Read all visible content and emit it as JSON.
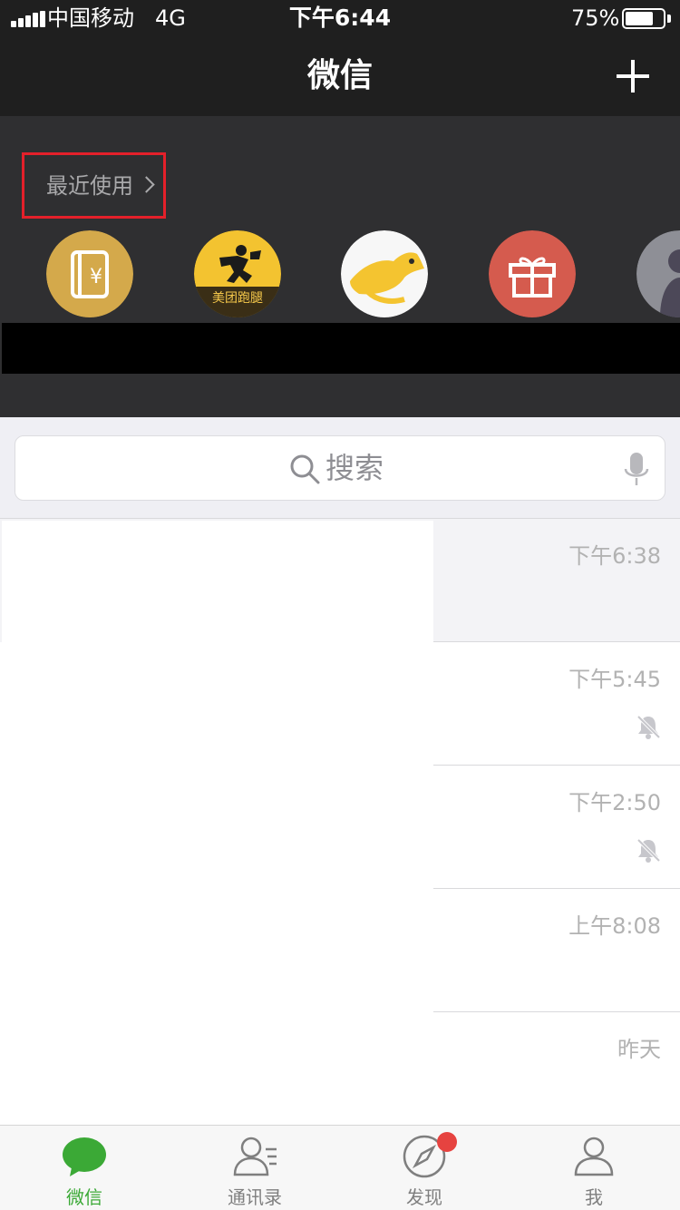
{
  "status_bar": {
    "carrier": "中国移动",
    "network": "4G",
    "time": "下午6:44",
    "battery_percent": "75%",
    "battery_level": 0.75
  },
  "nav": {
    "title": "微信",
    "add_icon": "plus-icon"
  },
  "recent": {
    "label": "最近使用",
    "apps": [
      {
        "icon": "wallet-yuan-icon",
        "color": "#d4a94b"
      },
      {
        "icon": "meituan-runner-icon",
        "text": "美团跑腿",
        "color": "#f3c330"
      },
      {
        "icon": "kangaroo-icon",
        "color": "#f5f5f5"
      },
      {
        "icon": "gift-icon",
        "color": "#d55b4e"
      },
      {
        "icon": "person-avatar-icon",
        "color": "#8e8f96"
      }
    ]
  },
  "search": {
    "placeholder": "搜索",
    "search_icon": "search-icon",
    "voice_icon": "microphone-icon"
  },
  "chats": [
    {
      "time": "下午6:38",
      "muted": false,
      "pinned": true
    },
    {
      "time": "下午5:45",
      "muted": true,
      "pinned": false
    },
    {
      "time": "下午2:50",
      "muted": true,
      "pinned": false
    },
    {
      "time": "上午8:08",
      "muted": false,
      "pinned": false
    },
    {
      "time": "昨天",
      "muted": false,
      "pinned": false
    }
  ],
  "tabs": [
    {
      "label": "微信",
      "icon": "chat-bubble-icon",
      "active": true,
      "badge": false
    },
    {
      "label": "通讯录",
      "icon": "contacts-icon",
      "active": false,
      "badge": false
    },
    {
      "label": "发现",
      "icon": "compass-icon",
      "active": false,
      "badge": true
    },
    {
      "label": "我",
      "icon": "profile-icon",
      "active": false,
      "badge": false
    }
  ],
  "colors": {
    "accent_green": "#3ba936",
    "badge_red": "#e64340",
    "highlight_red": "#e4202a"
  }
}
